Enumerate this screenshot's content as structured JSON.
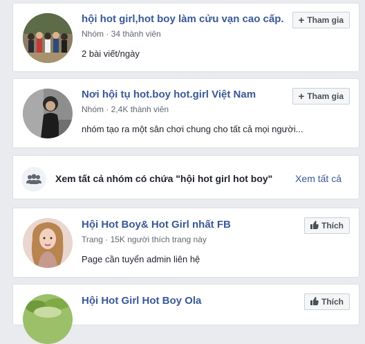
{
  "results": [
    {
      "title": "hội hot girl,hot boy làm cửu vạn cao cấp.",
      "meta": "Nhóm · 34 thành viên",
      "description": "2 bài viết/ngày",
      "action_label": "Tham gia",
      "action_icon": "plus-icon"
    },
    {
      "title": "Nơi hội tụ hot.boy hot.girl Việt Nam",
      "meta": "Nhóm · 2,4K thành viên",
      "description": "nhóm tạo ra một sân chơi chung cho tất cả mọi người...",
      "action_label": "Tham gia",
      "action_icon": "plus-icon"
    }
  ],
  "see_all": {
    "text": "Xem tất cả nhóm có chứa \"hội hot girl hot boy\"",
    "link": "Xem tất cả",
    "icon": "groups-icon"
  },
  "pages": [
    {
      "title": "Hội Hot Boy& Hot Girl nhất FB",
      "meta": "Trang · 15K người thích trang này",
      "description": "Page cần tuyển admin liên hệ",
      "action_label": "Thích",
      "action_icon": "thumbs-up-icon"
    },
    {
      "title": "Hội Hot Girl Hot Boy Ola",
      "action_label": "Thích",
      "action_icon": "thumbs-up-icon"
    }
  ],
  "colors": {
    "link_blue": "#385898",
    "background": "#e9ebee",
    "button_bg": "#f5f6f7"
  }
}
